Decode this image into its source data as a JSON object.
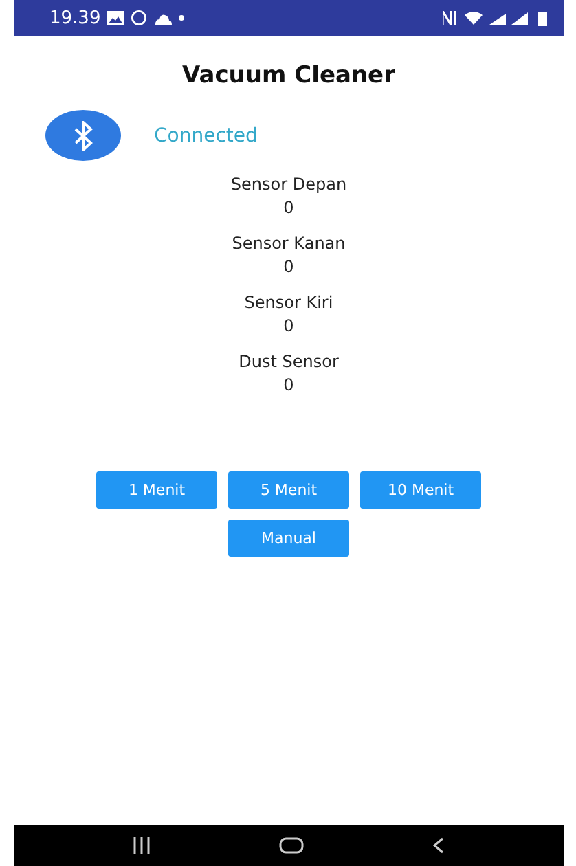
{
  "status_bar": {
    "time": "19.39"
  },
  "title": "Vacuum Cleaner",
  "bluetooth": {
    "connected": true,
    "status": "Connected"
  },
  "sensors": [
    {
      "label": "Sensor Depan",
      "value": "0"
    },
    {
      "label": "Sensor Kanan",
      "value": "0"
    },
    {
      "label": "Sensor Kiri",
      "value": "0"
    },
    {
      "label": "Dust Sensor",
      "value": "0"
    }
  ],
  "button_rows": [
    [
      "1 Menit",
      "5 Menit",
      "10 Menit"
    ],
    [
      "Manual"
    ]
  ]
}
